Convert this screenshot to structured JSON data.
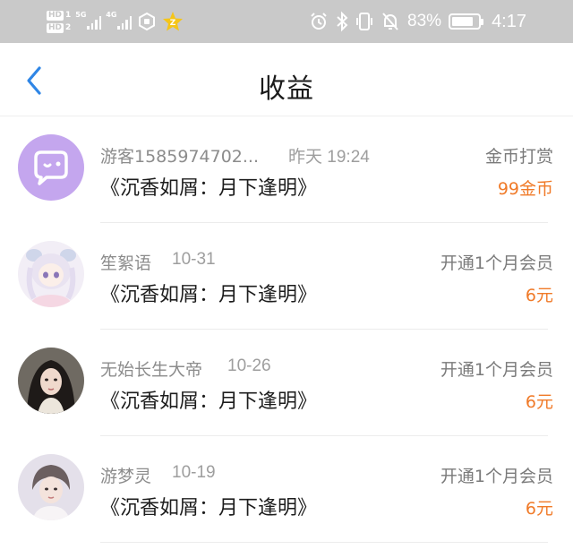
{
  "status_bar": {
    "hd1": "HD",
    "hd1_num": "1",
    "hd2": "HD",
    "hd2_num": "2",
    "net1": "5G",
    "net2": "4G",
    "battery_percent": "83%",
    "battery_level": 0.83,
    "time": "4:17"
  },
  "header": {
    "title": "收益"
  },
  "records": [
    {
      "user": "游客1585974702...",
      "date": "昨天 19:24",
      "book": "《沉香如屑：月下逢明》",
      "type": "金币打赏",
      "amount": "99金币"
    },
    {
      "user": "笙絮语",
      "date": "10-31",
      "book": "《沉香如屑：月下逢明》",
      "type": "开通1个月会员",
      "amount": "6元"
    },
    {
      "user": "无始长生大帝",
      "date": "10-26",
      "book": "《沉香如屑：月下逢明》",
      "type": "开通1个月会员",
      "amount": "6元"
    },
    {
      "user": "游梦灵",
      "date": "10-19",
      "book": "《沉香如屑：月下逢明》",
      "type": "开通1个月会员",
      "amount": "6元"
    }
  ],
  "colors": {
    "accent_blue": "#2f86e6",
    "amount_orange": "#f07a28",
    "status_bar_bg": "#c9c9c9"
  }
}
